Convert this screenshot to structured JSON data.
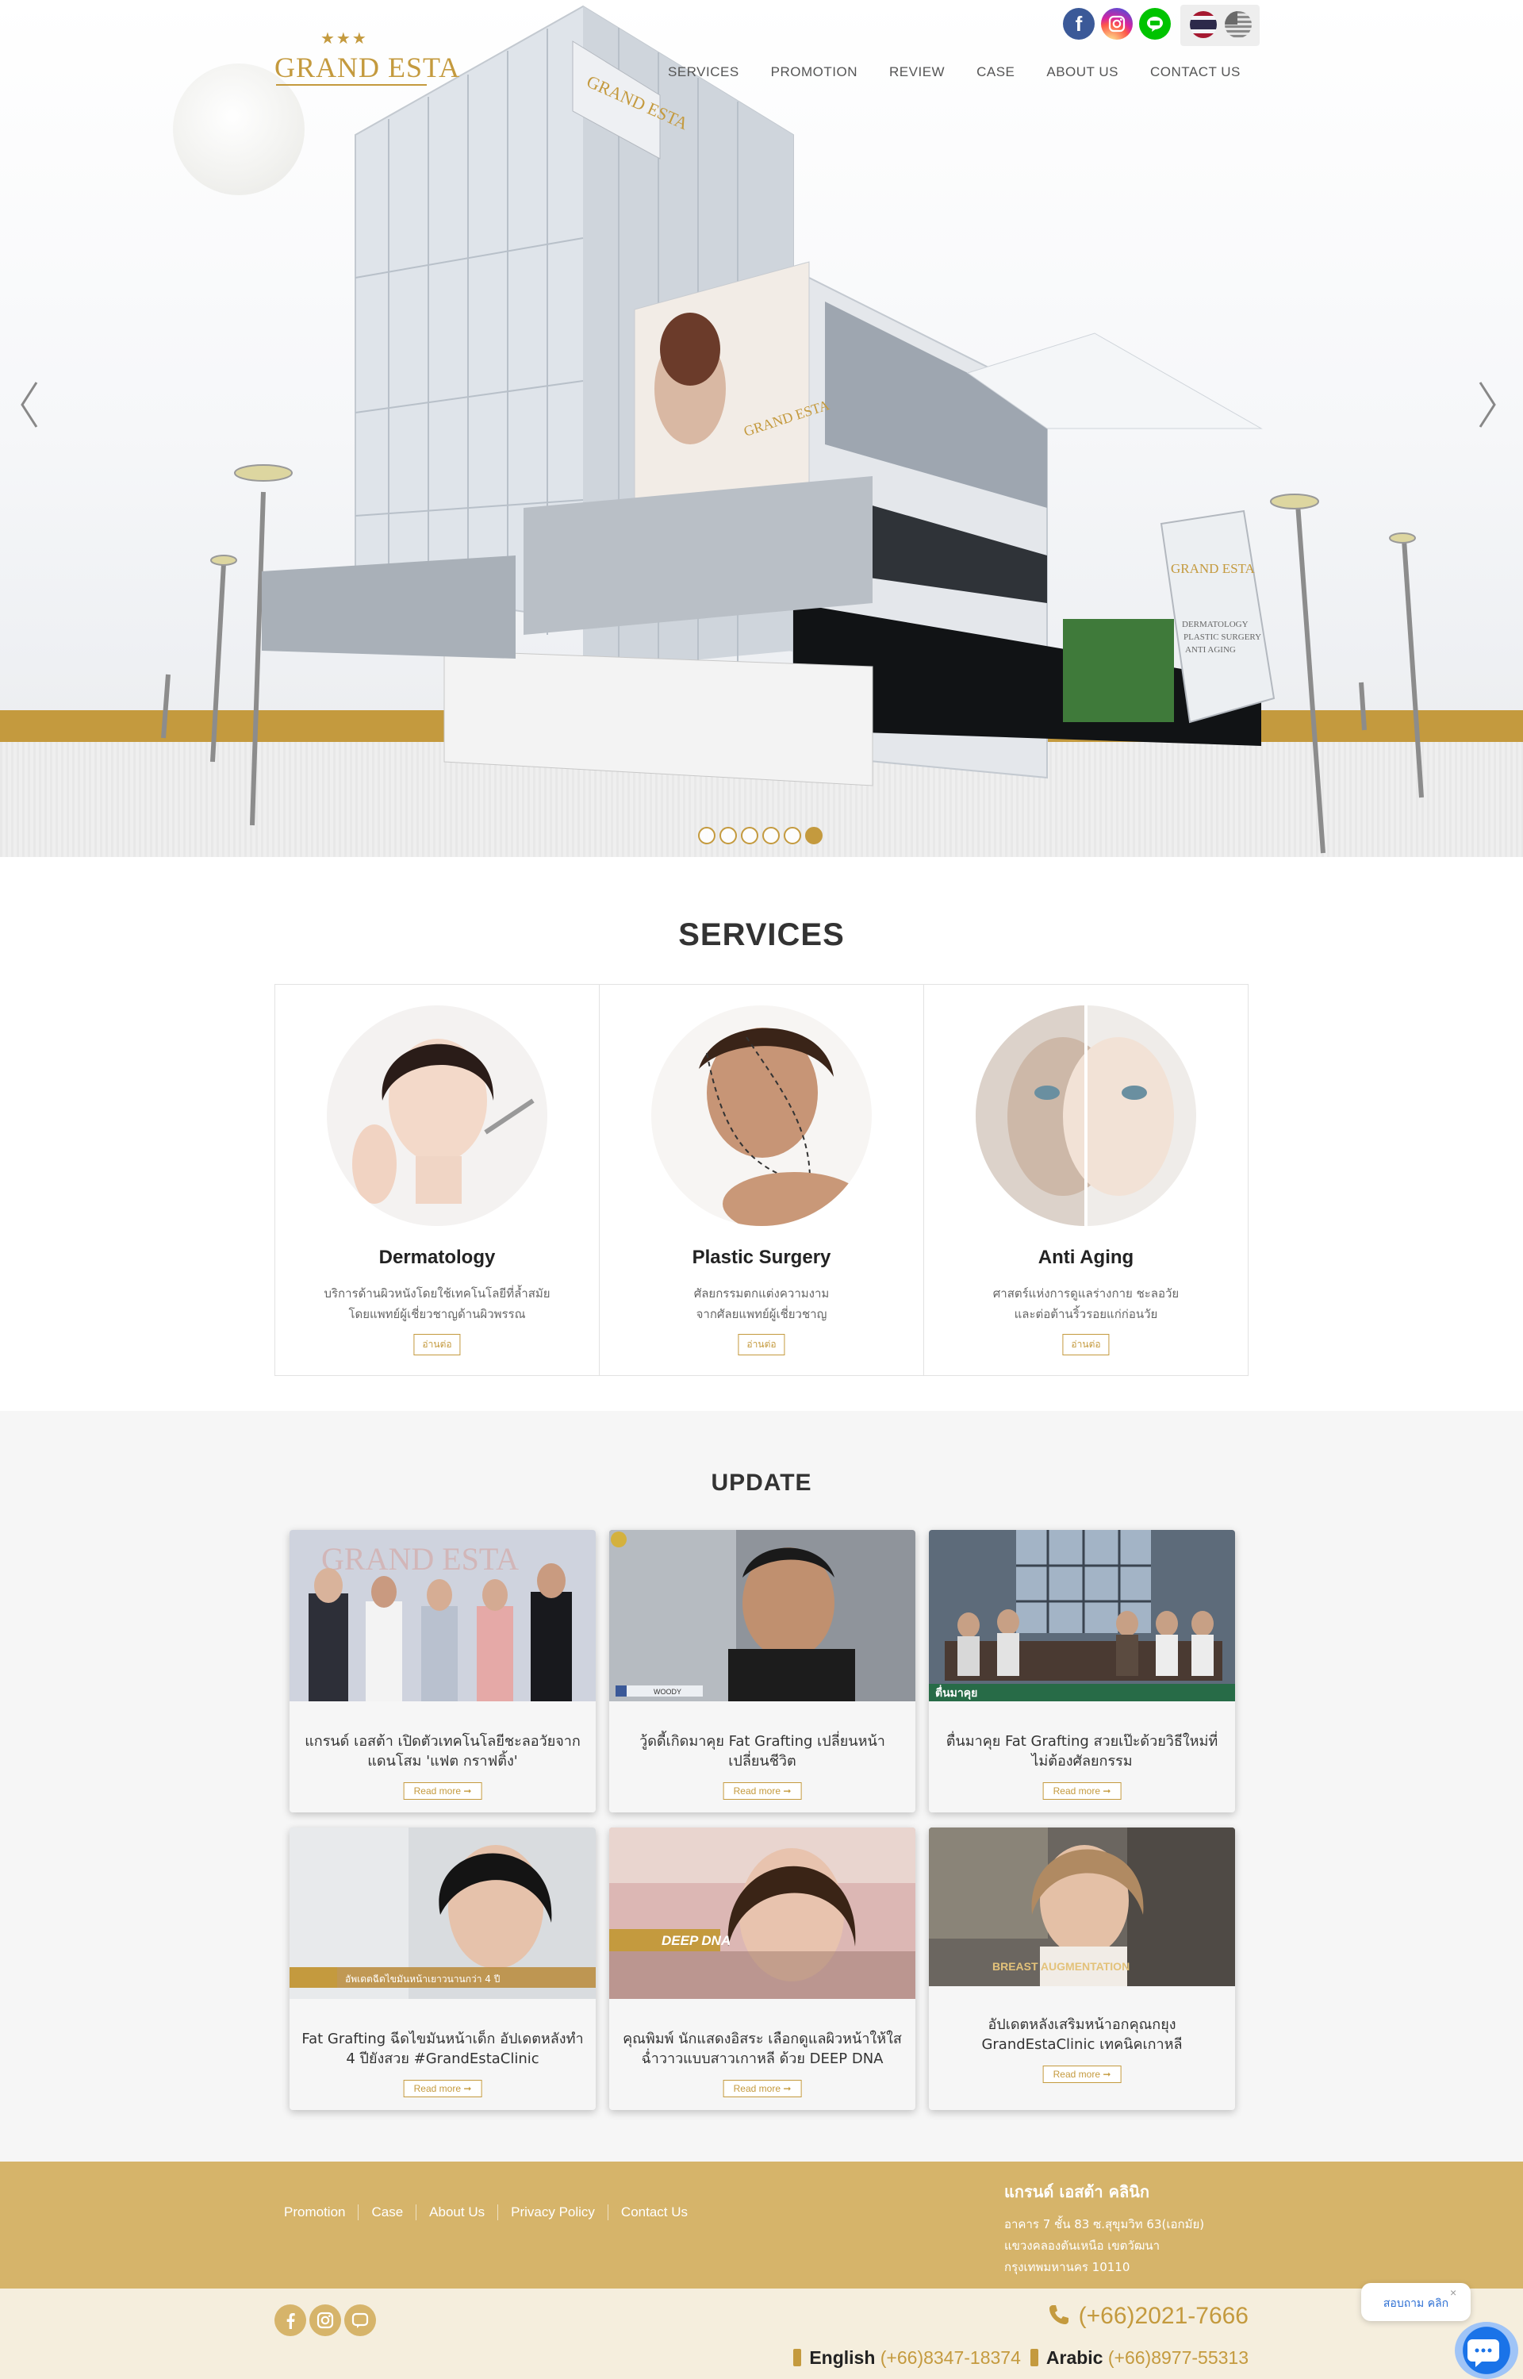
{
  "header": {
    "logo_text": "GRAND ESTA",
    "nav": [
      "SERVICES",
      "PROMOTION",
      "REVIEW",
      "CASE",
      "ABOUT US",
      "CONTACT US"
    ],
    "social_icons": [
      "facebook-icon",
      "instagram-icon",
      "line-icon"
    ],
    "languages": [
      "Thai",
      "English"
    ]
  },
  "hero": {
    "slide_count": 6,
    "active_slide": 6,
    "building_sign": "GRAND ESTA",
    "pylon_sign": "GRAND ESTA",
    "pylon_items": [
      "DERMATOLOGY",
      "PLASTIC SURGERY",
      "ANTI AGING"
    ]
  },
  "services": {
    "title": "SERVICES",
    "items": [
      {
        "name": "Dermatology",
        "desc": [
          "บริการด้านผิวหนังโดยใช้เทคโนโลยีที่ล้ำสมัย",
          "โดยแพทย์ผู้เชี่ยวชาญด้านผิวพรรณ"
        ],
        "button": "อ่านต่อ"
      },
      {
        "name": "Plastic Surgery",
        "desc": [
          "ศัลยกรรมตกแต่งความงาม",
          "จากศัลยแพทย์ผู้เชี่ยวชาญ"
        ],
        "button": "อ่านต่อ"
      },
      {
        "name": "Anti Aging",
        "desc": [
          "ศาสตร์แห่งการดูแลร่างกาย ชะลอวัย",
          "และต่อต้านริ้วรอยแก่ก่อนวัย"
        ],
        "button": "อ่านต่อ"
      }
    ]
  },
  "update": {
    "title": "UPDATE",
    "read_more": "Read more ➞",
    "cards": [
      {
        "title": "แกรนด์ เอสต้า เปิดตัวเทคโนโลยีชะลอวัยจากแดนโสม 'แฟต กราฟติ้ง'",
        "thumb_text": "GRAND ESTA"
      },
      {
        "title": "วู้ดดี้เกิดมาคุย Fat Grafting เปลี่ยนหน้าเปลี่ยนชีวิต",
        "thumb_text": "WOODY"
      },
      {
        "title": "ตื่นมาคุย Fat Grafting สวยเป๊ะด้วยวิธีใหม่ที่ไม่ต้องศัลยกรรม",
        "thumb_text": "ตื่นมาคุย"
      },
      {
        "title": "Fat Grafting ฉีดไขมันหน้าเด็ก อัปเดตหลังทำ 4 ปียังสวย #GrandEstaClinic",
        "thumb_text": "อัพเดตฉีดไขมันหน้าเยาวนานกว่า 4 ปี"
      },
      {
        "title": "คุณพิมพ์ นักแสดงอิสระ เลือกดูแลผิวหน้าให้ใสฉ่ำวาวแบบสาวเกาหลี ด้วย DEEP DNA",
        "thumb_text": "DEEP DNA"
      },
      {
        "title": "อัปเดตหลังเสริมหน้าอกคุณกยุง GrandEstaClinic เทคนิคเกาหลี",
        "thumb_text": "BREAST AUGMENTATION"
      }
    ]
  },
  "footer": {
    "links": [
      "Promotion",
      "Case",
      "About Us",
      "Privacy Policy",
      "Contact Us"
    ],
    "clinic_name": "แกรนด์ เอสต้า คลินิก",
    "address": [
      "อาคาร 7 ชั้น 83 ซ.สุขุมวิท 63(เอกมัย)",
      "แขวงคลองตันเหนือ เขตวัฒนา",
      "กรุงเทพมหานคร 10110"
    ],
    "phone_main": "(+66)2021-7666",
    "english_label": "English",
    "english_phone": "(+66)8347-18374",
    "arabic_label": "Arabic",
    "arabic_phone": "(+66)8977-55313",
    "social_icons": [
      "facebook-icon",
      "instagram-icon",
      "line-icon"
    ]
  },
  "chat": {
    "prompt": "สอบถาม คลิก",
    "close": "×"
  },
  "colors": {
    "gold": "#c49a3e",
    "gold_light": "#d6b46a",
    "cream": "#f5eedd",
    "section_bg": "#f6f6f6"
  }
}
